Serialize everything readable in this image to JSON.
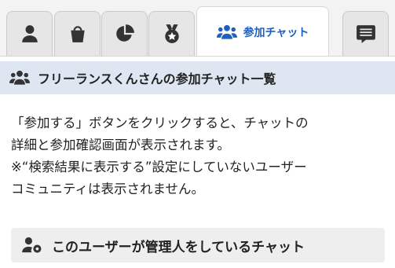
{
  "tabs": [
    {
      "icon": "user-icon",
      "label": ""
    },
    {
      "icon": "bucket-icon",
      "label": ""
    },
    {
      "icon": "pie-chart-icon",
      "label": ""
    },
    {
      "icon": "medal-icon",
      "label": ""
    },
    {
      "icon": "users-icon",
      "label": "参加チャット",
      "active": true
    },
    {
      "icon": "chat-list-icon",
      "label": ""
    }
  ],
  "section": {
    "title": "フリーランスくんさんの参加チャット一覧"
  },
  "description": {
    "line1": "「参加する」ボタンをクリックすると、チャットの",
    "line2": "詳細と参加確認画面が表示されます。",
    "line3": "※“検索結果に表示する”設定にしていないユーザー",
    "line4": "コミュニティは表示されません。"
  },
  "admin_section": {
    "title": "このユーザーが管理人をしているチャット"
  },
  "colors": {
    "accent": "#1f5fbf",
    "header_bg": "#dde6f1",
    "tab_bg": "#e6e6e6"
  }
}
